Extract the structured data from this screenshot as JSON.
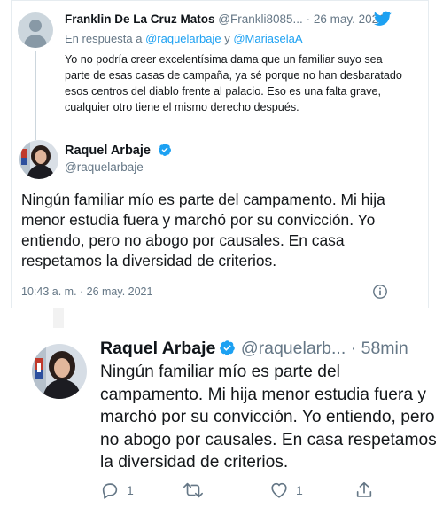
{
  "reply_tweet": {
    "author_name": "Franklin De La Cruz Matos",
    "author_handle": "@Frankli8085...",
    "separator": "·",
    "date": "26 may. 2021",
    "reply_prefix": "En respuesta a",
    "reply_user1": "@raquelarbaje",
    "reply_and": "y",
    "reply_user2": "@MariaselaA",
    "text": "Yo no podría creer excelentísima dama que un familiar suyo sea parte de esas casas de campaña, ya sé porque no han desbaratado esos centros del diablo frente al palacio. Eso es una falta grave, cualquier otro tiene el mismo derecho después."
  },
  "main_tweet": {
    "author_name": "Raquel Arbaje",
    "author_handle": "@raquelarbaje",
    "text": "Ningún familiar mío es parte del campamento. Mi hija menor estudia fuera y marchó por su convicción. Yo entiendo, pero no abogo por causales. En casa respetamos la diversidad de criterios.",
    "timestamp": "10:43 a. m. · 26 may. 2021"
  },
  "mobile_tweet": {
    "author_name": "Raquel Arbaje",
    "author_handle": "@raquelarb...",
    "time_ago": "· 58min",
    "text": "Ningún familiar mío es parte del campamento. Mi hija menor estudia fuera y marchó por su convicción. Yo entiendo, pero no abogo por causales. En casa respetamos la diversidad de criterios.",
    "reply_count": "1",
    "like_count": "1"
  },
  "colors": {
    "twitter_blue": "#1da1f2",
    "muted_text": "#657786",
    "border": "#e6ecf0"
  },
  "icons": [
    "twitter-bird-icon",
    "verified-icon",
    "info-icon",
    "reply-icon",
    "retweet-icon",
    "like-icon",
    "share-icon"
  ]
}
